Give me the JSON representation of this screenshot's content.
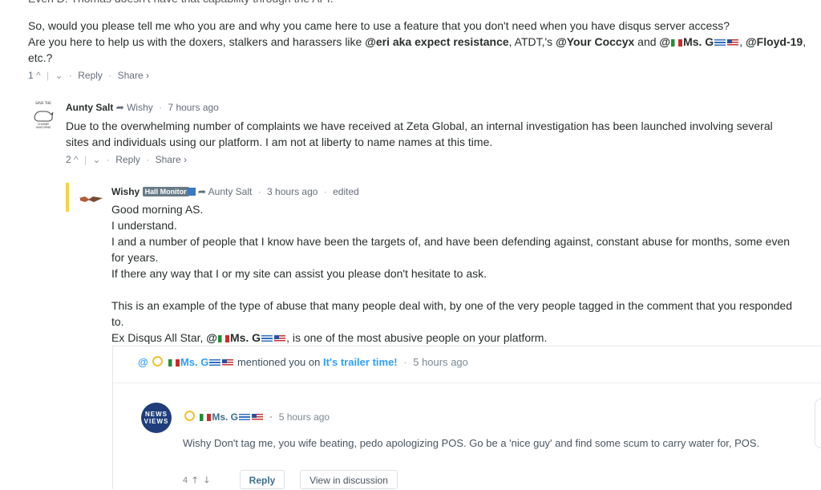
{
  "cutoff_text": "Even D. Thomas doesn't have that capability through the API.",
  "comment1": {
    "line1": "So, would you please tell me who you are and why you came here to use a feature that you don't need when you have disqus server access?",
    "line2_pre": "Are you here to help us with the doxers, stalkers and harassers like ",
    "mention1": "@eri aka expect resistance",
    "mid1": ", ATDT,'s ",
    "mention2": "@Your Coccyx",
    "mid2": " and ",
    "mention3_a": "@",
    "mention3_b": "Ms. G",
    "mid3": ", ",
    "mention4": "@Floyd-19",
    "tail": ", etc.?",
    "votes": "1",
    "reply": "Reply",
    "share": "Share ›"
  },
  "comment2": {
    "avatar_text": "SAVE THE CHUBBY UNICORNS",
    "author": "Aunty Salt",
    "reply_to": "Wishy",
    "time": "7 hours ago",
    "line1": "Due to the overwhelming number of complaints we have received at Zeta Global, an internal investigation has been launched involving several",
    "line2": "sites and individuals using our platform. I am not at liberty to name names at this time.",
    "votes": "2",
    "reply": "Reply",
    "share": "Share ›"
  },
  "comment3": {
    "author": "Wishy",
    "badge": "Hall Monitor",
    "reply_to": "Aunty Salt",
    "time": "3 hours ago",
    "edited": "edited",
    "lines": [
      "Good morning AS.",
      "I understand.",
      "I and a number of people that I know have been the targets of, and have been defending against, constant abuse for months, some even",
      "for years.",
      "If there any way that I or my site can assist you please don't hesitate to ask."
    ],
    "para2_line1": "This is an example of the type of abuse that many people deal with, by one of the very people tagged in the comment that you responded",
    "para2_line2": "to.",
    "para2_line3_pre": "Ex Disqus All Star, ",
    "para2_line3_at": "@",
    "para2_line3_name": "Ms. G",
    "para2_line3_post": ", is one of the most abusive people on your platform."
  },
  "embed": {
    "at": "@",
    "name": "Ms. G",
    "mentioned": "mentioned you on",
    "thread": "It's trailer time!",
    "head_time": "5 hours ago",
    "avatar_text": "NEWS VIEWS",
    "comment_name": "Ms. G",
    "comment_time": "5 hours ago",
    "comment_text": "Wishy Don't tag me, you wife beating, pedo apologizing POS. Go be a 'nice guy' and find some scum to carry water for, POS.",
    "votes": "4",
    "reply": "Reply",
    "view": "View in discussion"
  }
}
